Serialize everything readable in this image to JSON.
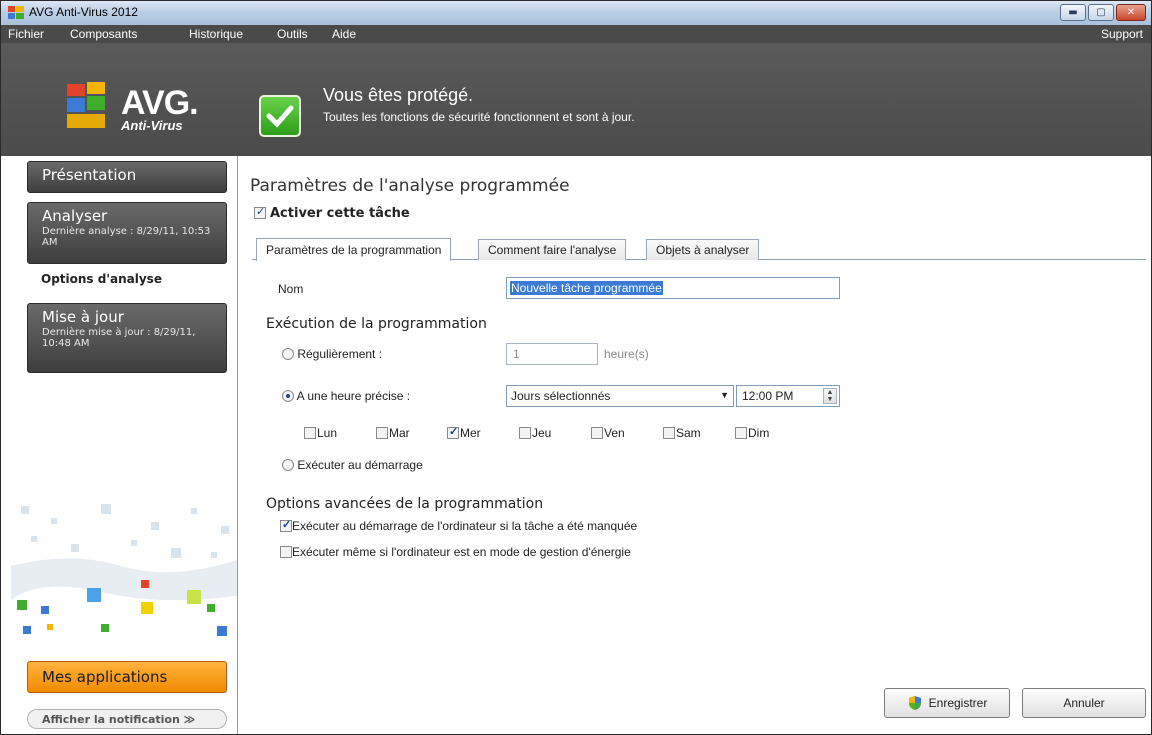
{
  "window": {
    "title": "AVG Anti-Virus 2012"
  },
  "menu": {
    "items": [
      "Fichier",
      "Composants",
      "Historique",
      "Outils",
      "Aide"
    ],
    "support": "Support"
  },
  "header": {
    "logo_text": "AVG.",
    "logo_sub": "Anti-Virus",
    "status_title": "Vous êtes protégé.",
    "status_sub": "Toutes les fonctions de sécurité fonctionnent et sont à jour."
  },
  "sidebar": {
    "presentation": "Présentation",
    "scan": {
      "label": "Analyser",
      "sub": "Dernière analyse : 8/29/11, 10:53 AM"
    },
    "options": "Options d'analyse",
    "update": {
      "label": "Mise à jour",
      "sub": "Dernière mise à jour : 8/29/11, 10:48 AM"
    },
    "apps": "Mes applications",
    "notif": "Afficher la notification ≫"
  },
  "main": {
    "title": "Paramètres de l'analyse programmée",
    "enable": "Activer cette tâche",
    "tabs": [
      "Paramètres de la programmation",
      "Comment faire l'analyse",
      "Objets à analyser"
    ],
    "name_label": "Nom",
    "name_value": "Nouvelle tâche programmée",
    "section_exec": "Exécution de la programmation",
    "regular_label": "Régulièrement :",
    "hours_value": "1",
    "hours_unit": "heure(s)",
    "precise_label": "A une heure précise :",
    "select_value": "Jours sélectionnés",
    "time_value": "12:00 PM",
    "days": [
      "Lun",
      "Mar",
      "Mer",
      "Jeu",
      "Ven",
      "Sam",
      "Dim"
    ],
    "startup_label": "Exécuter au démarrage",
    "section_adv": "Options avancées de la programmation",
    "adv1": "Exécuter au démarrage de l'ordinateur si la tâche a été manquée",
    "adv2": "Exécuter même si l'ordinateur est en mode de gestion d'énergie"
  },
  "buttons": {
    "save": "Enregistrer",
    "cancel": "Annuler"
  }
}
